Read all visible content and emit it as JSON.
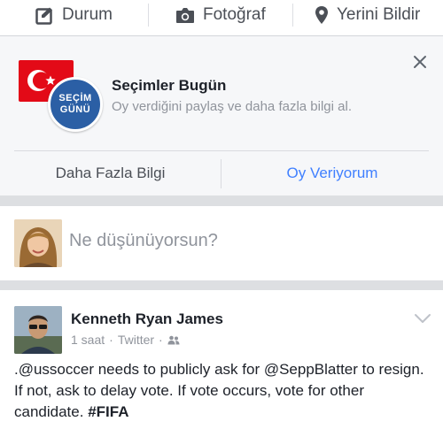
{
  "composer_bar": {
    "status_label": "Durum",
    "photo_label": "Fotoğraf",
    "checkin_label": "Yerini Bildir"
  },
  "election": {
    "badge_line1": "SEÇİM",
    "badge_line2": "GÜNÜ",
    "title": "Seçimler Bugün",
    "subtitle": "Oy verdiğini paylaş ve daha fazla bilgi al.",
    "more_info_label": "Daha Fazla Bilgi",
    "voting_label": "Oy Veriyorum",
    "accent_color": "#4080ff",
    "flag_color": "#e30a17"
  },
  "composer": {
    "placeholder": "Ne düşünüyorsun?"
  },
  "post": {
    "author": "Kenneth Ryan James",
    "time": "1 saat",
    "source": "Twitter",
    "dot": "·",
    "text": ".@ussoccer needs to publicly ask for @SeppBlatter to resign. If not, ask to delay vote. If vote occurs, vote for other candidate.",
    "hashtag": "#FIFA"
  },
  "icons": {
    "status": "edit-icon",
    "photo": "camera-icon",
    "checkin": "location-pin-icon",
    "close": "close-icon",
    "audience": "friends-icon",
    "menu": "chevron-down-icon"
  }
}
